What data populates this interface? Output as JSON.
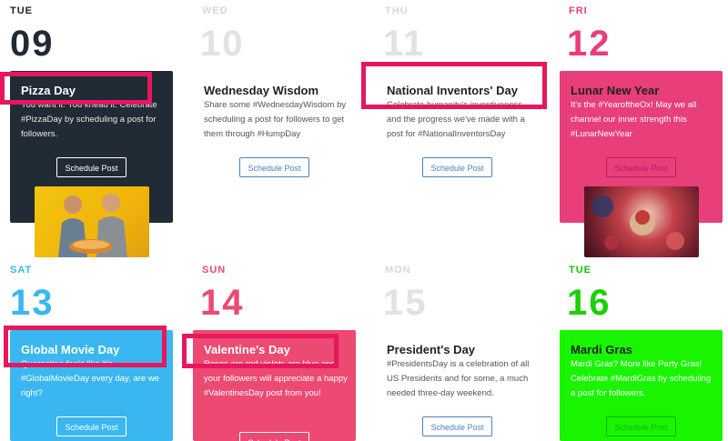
{
  "days": [
    {
      "dow": "TUE",
      "num": "09",
      "title": "Pizza Day",
      "desc": "You want it. You knead it. Celebrate #PizzaDay by scheduling a post for followers.",
      "button": "Schedule Post"
    },
    {
      "dow": "WED",
      "num": "10",
      "title": "Wednesday Wisdom",
      "desc": "Share some #WednesdayWisdom by scheduling a post for followers to get them through #HumpDay",
      "button": "Schedule Post"
    },
    {
      "dow": "THU",
      "num": "11",
      "title": "National Inventors' Day",
      "desc": "Celebrate humanity's inventiveness and the progress we've made with a post for #NationalInventorsDay",
      "button": "Schedule Post"
    },
    {
      "dow": "FRI",
      "num": "12",
      "title": "Lunar New Year",
      "desc": "It's the #YearoftheOx! May we all channel our inner strength this #LunarNewYear",
      "button": "Schedule Post"
    },
    {
      "dow": "SAT",
      "num": "13",
      "title": "Global Movie Day",
      "desc": "Quarantine feels like it's #GlobalMovieDay every day, are we right?",
      "button": "Schedule Post"
    },
    {
      "dow": "SUN",
      "num": "14",
      "title": "Valentine's Day",
      "desc": "Roses are red violets are blue and your followers will appreciate a happy #ValentinesDay post from you!",
      "button": "Schedule Post"
    },
    {
      "dow": "MON",
      "num": "15",
      "title": "President's Day",
      "desc": "#PresidentsDay is a celebration of all US Presidents and for some, a much needed three-day weekend.",
      "button": "Schedule Post"
    },
    {
      "dow": "TUE",
      "num": "16",
      "title": "Mardi Gras",
      "desc": "Mardi Gras? More like Party Gras! Celebrate #MardiGras by scheduling a post for followers.",
      "button": "Schedule Post"
    }
  ],
  "colors": {
    "dark": "#202b36",
    "pink": "#e83e7a",
    "blue": "#3ab7f0",
    "rose": "#ec4a72",
    "green": "#19f500",
    "highlight": "#e8175d"
  }
}
